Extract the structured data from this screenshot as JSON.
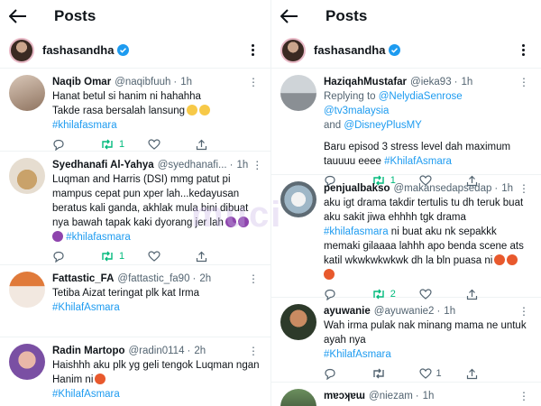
{
  "left": {
    "header_title": "Posts",
    "profile_name": "fashasandha",
    "tweets": [
      {
        "name": "Naqib Omar",
        "handle": "@naqibfuuh",
        "time": "1h",
        "lines": [
          "Hanat betul si hanim ni hahahha",
          "Takde rasa bersalah lansung"
        ],
        "hashtag": "#khilafasmara",
        "retweets": "1"
      },
      {
        "name": "Syedhanafi Al-Yahya",
        "handle": "@syedhanafi...",
        "time": "1h",
        "lines": [
          "Luqman and Harris (DSI) mmg patut pi",
          "mampus cepat pun xper lah...kedayusan",
          "beratus kali ganda, akhlak mula bini dibuat",
          "nya bawah tapak kaki dyorang jer lah"
        ],
        "hashtag": "#khilafasmara",
        "retweets": "1"
      },
      {
        "name": "Fattastic_FA",
        "handle": "@fattastic_fa90",
        "time": "2h",
        "lines": [
          "Tetiba Aizat teringat plk kat Irma"
        ],
        "hashtag": "#KhilafAsmara"
      },
      {
        "name": "Radin Martopo",
        "handle": "@radin0114",
        "time": "2h",
        "lines": [
          "Haishhh aku plk yg geli tengok Luqman ngan",
          "Hanim ni"
        ],
        "hashtag": "#KhilafAsmara"
      }
    ]
  },
  "right": {
    "header_title": "Posts",
    "profile_name": "fashasandha",
    "tweets": [
      {
        "name": "HaziqahMustafar",
        "handle": "@ieka93",
        "time": "1h",
        "replying_prefix": "Replying to",
        "mention1": "@NelydiaSenrose",
        "mention2": "@tv3malaysia",
        "and_word": "and",
        "mention3": "@DisneyPlusMY",
        "line": "Baru episod 3 stress level dah maximum",
        "line2": "tauuuu eeee",
        "hashtag": "#KhilafAsmara",
        "retweets": "1"
      },
      {
        "name": "penjualbakso",
        "handle": "@makansedapsedap",
        "time": "1h",
        "lines": [
          "aku igt drama takdir tertulis tu dh teruk buat",
          "aku sakit jiwa ehhhh tgk drama"
        ],
        "hashtag": "#khilafasmara",
        "line3": "ni buat aku nk sepakkk",
        "line4": "memaki gilaaaa lahhh apo benda scene ats",
        "line5": "katil wkwkwkwkwk dh la bln puasa ni",
        "retweets": "2"
      },
      {
        "name": "ayuwanie",
        "handle": "@ayuwanie2",
        "time": "1h",
        "lines": [
          "Wah irma pulak nak minang mama ne untuk",
          "ayah nya"
        ],
        "hashtag": "#KhilafAsmara",
        "likes": "1"
      },
      {
        "name": "mɐɔʞɐɯ",
        "handle": "@niezam",
        "time": "1h"
      }
    ]
  },
  "watermark": "muci",
  "colors": {
    "accent": "#1d9bf0",
    "retweet": "#00ba7c",
    "muted": "#536471"
  }
}
